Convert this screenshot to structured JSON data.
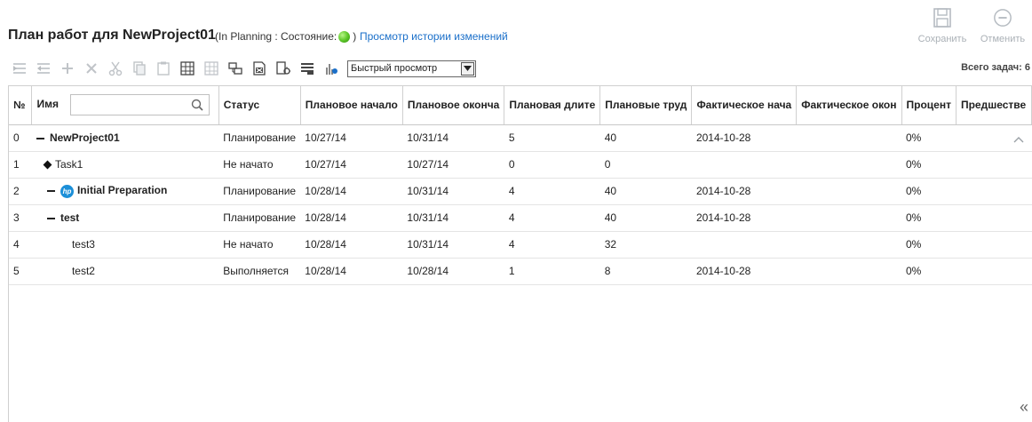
{
  "header": {
    "title": "План работ для NewProject01",
    "info_prefix": "(In Planning : Состояние:",
    "info_suffix": ")",
    "history_link": "Просмотр истории изменений"
  },
  "actions": {
    "save_label": "Сохранить",
    "cancel_label": "Отменить"
  },
  "toolbar": {
    "icons": [
      "indent-icon",
      "outdent-icon",
      "add-icon",
      "delete-icon",
      "cut-icon",
      "copy-icon",
      "paste-icon",
      "grid-icon",
      "grid-disabled-icon",
      "link-icon",
      "excel-export-icon",
      "settings-icon",
      "list-icon",
      "chart-icon"
    ],
    "quick_view": "Быстрый просмотр",
    "total_tasks": "Всего задач: 6"
  },
  "table": {
    "columns": [
      "№",
      "Имя",
      "Статус",
      "Плановое начало",
      "Плановое оконча",
      "Плановая длите",
      "Плановые труд",
      "Фактическое нача",
      "Фактическое окон",
      "Процент",
      "Предшестве"
    ],
    "rows": [
      {
        "num": "0",
        "name": "NewProject01",
        "status": "Планирование",
        "plan_start": "10/27/14",
        "plan_end": "10/31/14",
        "plan_duration": "5",
        "plan_effort": "40",
        "actual_start": "2014-10-28",
        "actual_end": "",
        "percent": "0%",
        "predecessor": ""
      },
      {
        "num": "1",
        "name": "Task1",
        "status": "Не начато",
        "plan_start": "10/27/14",
        "plan_end": "10/27/14",
        "plan_duration": "0",
        "plan_effort": "0",
        "actual_start": "",
        "actual_end": "",
        "percent": "0%",
        "predecessor": ""
      },
      {
        "num": "2",
        "name": "Initial Preparation",
        "status": "Планирование",
        "plan_start": "10/28/14",
        "plan_end": "10/31/14",
        "plan_duration": "4",
        "plan_effort": "40",
        "actual_start": "2014-10-28",
        "actual_end": "",
        "percent": "0%",
        "predecessor": ""
      },
      {
        "num": "3",
        "name": "test",
        "status": "Планирование",
        "plan_start": "10/28/14",
        "plan_end": "10/31/14",
        "plan_duration": "4",
        "plan_effort": "40",
        "actual_start": "2014-10-28",
        "actual_end": "",
        "percent": "0%",
        "predecessor": ""
      },
      {
        "num": "4",
        "name": "test3",
        "status": "Не начато",
        "plan_start": "10/28/14",
        "plan_end": "10/31/14",
        "plan_duration": "4",
        "plan_effort": "32",
        "actual_start": "",
        "actual_end": "",
        "percent": "0%",
        "predecessor": ""
      },
      {
        "num": "5",
        "name": "test2",
        "status": "Выполняется",
        "plan_start": "10/28/14",
        "plan_end": "10/28/14",
        "plan_duration": "1",
        "plan_effort": "8",
        "actual_start": "2014-10-28",
        "actual_end": "",
        "percent": "0%",
        "predecessor": ""
      }
    ]
  },
  "collapse_label": "«",
  "colors": {
    "link": "#1a6fc9",
    "status_ok": "#5ec82a",
    "disabled": "#aab0b6"
  }
}
